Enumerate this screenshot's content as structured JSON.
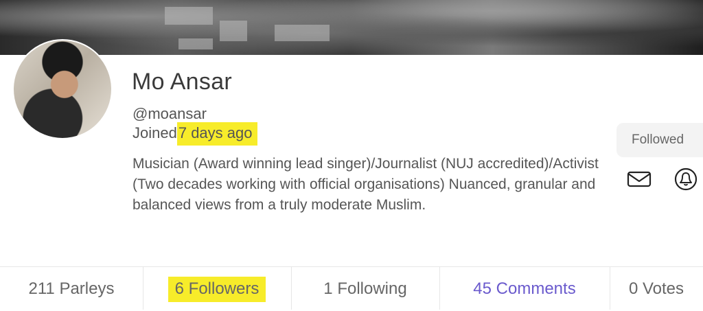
{
  "profile": {
    "name": "Mo Ansar",
    "handle": "@moansar",
    "joined_prefix": "Joined",
    "joined_value": "7 days ago",
    "bio": "Musician (Award winning lead singer)/Journalist (NUJ accredited)/Activist (Two decades working with official organisations) Nuanced, granular and balanced views from a truly moderate Muslim."
  },
  "actions": {
    "follow_label": "Followed",
    "message_icon": "mail-icon",
    "notify_icon": "bell-icon"
  },
  "tabs": [
    {
      "label": "211 Parleys"
    },
    {
      "label": "6 Followers"
    },
    {
      "label": "1 Following"
    },
    {
      "label": "45 Comments"
    },
    {
      "label": "0 Votes"
    }
  ],
  "colors": {
    "highlight": "#f7ec2a",
    "active_tab": "#6a5acd"
  }
}
